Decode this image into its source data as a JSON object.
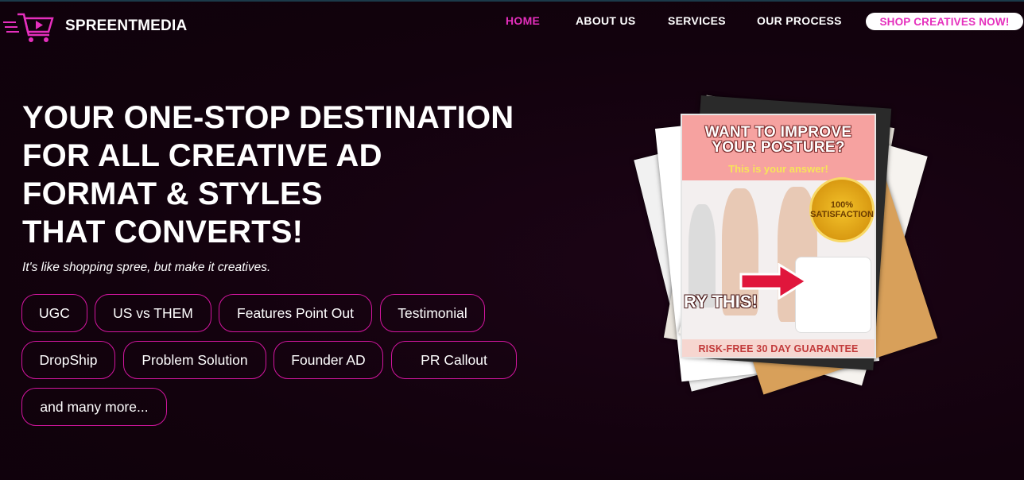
{
  "header": {
    "brand": "SPREENTMEDIA",
    "logo_icon": "shopping-cart-play-icon",
    "nav": [
      {
        "label": "HOME",
        "active": true
      },
      {
        "label": "ABOUT US",
        "active": false
      },
      {
        "label": "SERVICES",
        "active": false
      },
      {
        "label": "OUR PROCESS",
        "active": false
      }
    ],
    "cta_label": "SHOP CREATIVES NOW!"
  },
  "hero": {
    "headline_lines": [
      "YOUR ONE-STOP DESTINATION",
      "FOR ALL CREATIVE AD",
      "FORMAT & STYLES",
      "THAT CONVERTS!"
    ],
    "tagline": "It's like shopping spree, but make it creatives.",
    "ad_types": [
      "UGC",
      "US vs THEM",
      "Features Point Out",
      "Testimonial",
      "DropShip",
      "Problem Solution",
      "Founder AD",
      "PR Callout",
      "and many more..."
    ]
  },
  "ad_preview": {
    "title_line1": "WANT TO IMPROVE",
    "title_line2": "YOUR POSTURE?",
    "subtitle": "This is your answer!",
    "badge_text": "100% SATISFACTION",
    "overlay_text": "RY THIS!",
    "footer": "RISK-FREE 30 DAY GUARANTEE"
  },
  "colors": {
    "accent": "#e52fbd",
    "chip_border": "#d2169e",
    "background": "#14020f"
  }
}
